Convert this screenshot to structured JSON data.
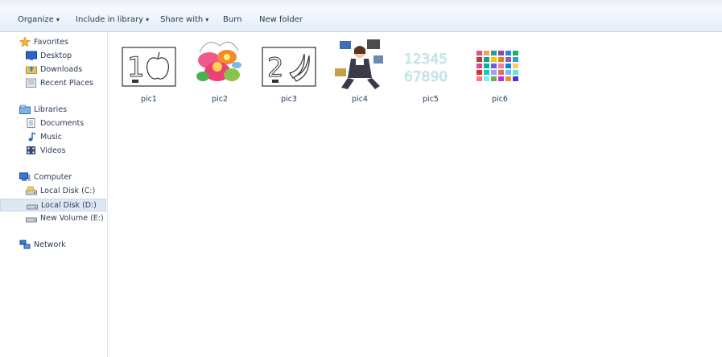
{
  "toolbar": {
    "organize": "Organize",
    "include": "Include in library",
    "share": "Share with",
    "burn": "Burn",
    "new_folder": "New folder"
  },
  "sidebar": {
    "favorites": {
      "label": "Favorites",
      "icon": "star-icon"
    },
    "desktop": {
      "label": "Desktop",
      "icon": "desktop-icon"
    },
    "downloads": {
      "label": "Downloads",
      "icon": "downloads-icon"
    },
    "recent": {
      "label": "Recent Places",
      "icon": "recent-places-icon"
    },
    "libraries": {
      "label": "Libraries",
      "icon": "libraries-icon"
    },
    "documents": {
      "label": "Documents",
      "icon": "document-icon"
    },
    "music": {
      "label": "Music",
      "icon": "music-icon"
    },
    "videos": {
      "label": "Videos",
      "icon": "video-icon"
    },
    "computer": {
      "label": "Computer",
      "icon": "computer-icon"
    },
    "disk_c": {
      "label": "Local Disk (C:)",
      "icon": "drive-icon"
    },
    "disk_d": {
      "label": "Local Disk (D:)",
      "icon": "drive-icon"
    },
    "volume_e": {
      "label": "New Volume (E:)",
      "icon": "drive-icon"
    },
    "network": {
      "label": "Network",
      "icon": "network-icon"
    }
  },
  "files": [
    {
      "name": "pic1",
      "icon": "number-one-apple-thumbnail"
    },
    {
      "name": "pic2",
      "icon": "flower-thumbnail"
    },
    {
      "name": "pic3",
      "icon": "number-two-banana-thumbnail"
    },
    {
      "name": "pic4",
      "icon": "businesswoman-thumbnail"
    },
    {
      "name": "pic5",
      "icon": "numbers-thumbnail"
    },
    {
      "name": "pic6",
      "icon": "color-grid-thumbnail"
    }
  ],
  "colors": {
    "toolbar_bg": "#e6edf7",
    "text": "#1e395b",
    "selected_bg": "#dfe7f2"
  }
}
